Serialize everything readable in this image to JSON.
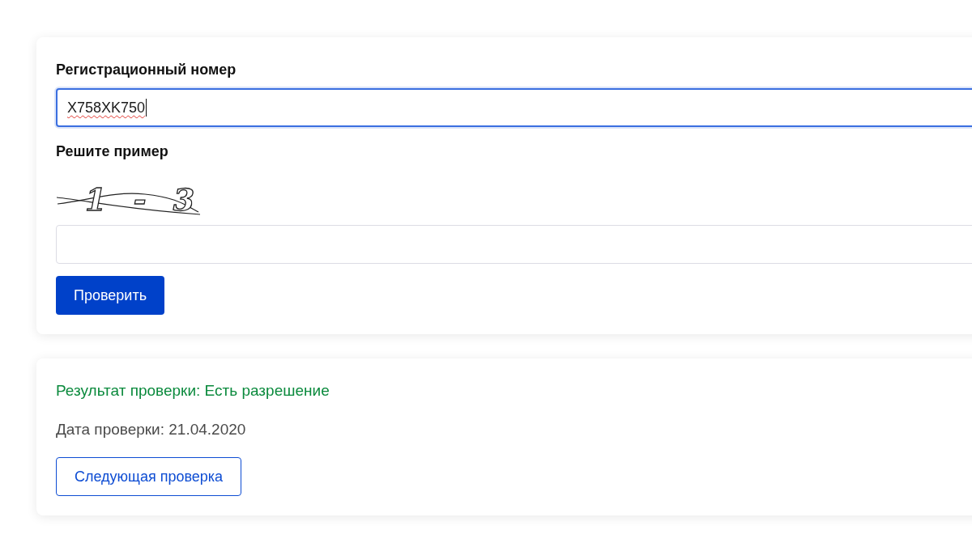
{
  "check_form": {
    "plate": {
      "label": "Регистрационный номер",
      "value": "X758XK750",
      "focused": true,
      "misspelled": true
    },
    "captcha": {
      "label": "Решите пример",
      "image_text": "1 - 3",
      "answer": {
        "focused": false
      }
    },
    "submit_button": "Проверить"
  },
  "result": {
    "status": "Результат проверки: Есть разрешение",
    "success": true,
    "date": "Дата проверки: 21.04.2020",
    "next_button": "Следующая проверка"
  }
}
